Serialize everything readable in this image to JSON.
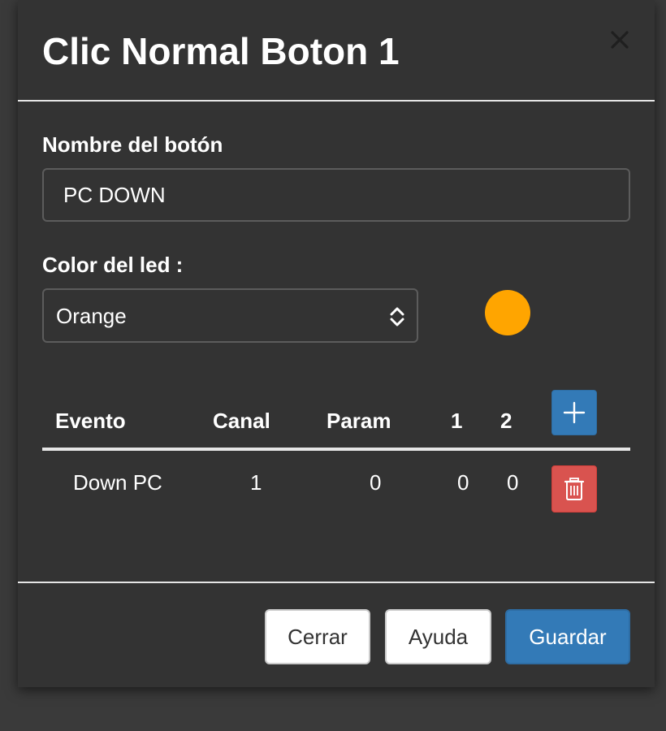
{
  "modal": {
    "title": "Clic Normal Boton 1"
  },
  "form": {
    "name_label": "Nombre del botón",
    "name_value": "PC DOWN",
    "color_label": "Color del led :",
    "color_selected": "Orange",
    "led_color": "#ffa500"
  },
  "table": {
    "headers": [
      "Evento",
      "Canal",
      "Param",
      "1",
      "2"
    ],
    "rows": [
      {
        "evento": "Down PC",
        "canal": "1",
        "param": "0",
        "p1": "0",
        "p2": "0"
      }
    ]
  },
  "footer": {
    "close_label": "Cerrar",
    "help_label": "Ayuda",
    "save_label": "Guardar"
  },
  "colors": {
    "modal_bg": "#333333",
    "primary": "#337ab7",
    "danger": "#d9534f",
    "led": "#ffa500"
  },
  "icons": {
    "close": "close-icon",
    "select": "chevron-up-down-icon",
    "add": "plus-icon",
    "delete": "trash-icon"
  }
}
